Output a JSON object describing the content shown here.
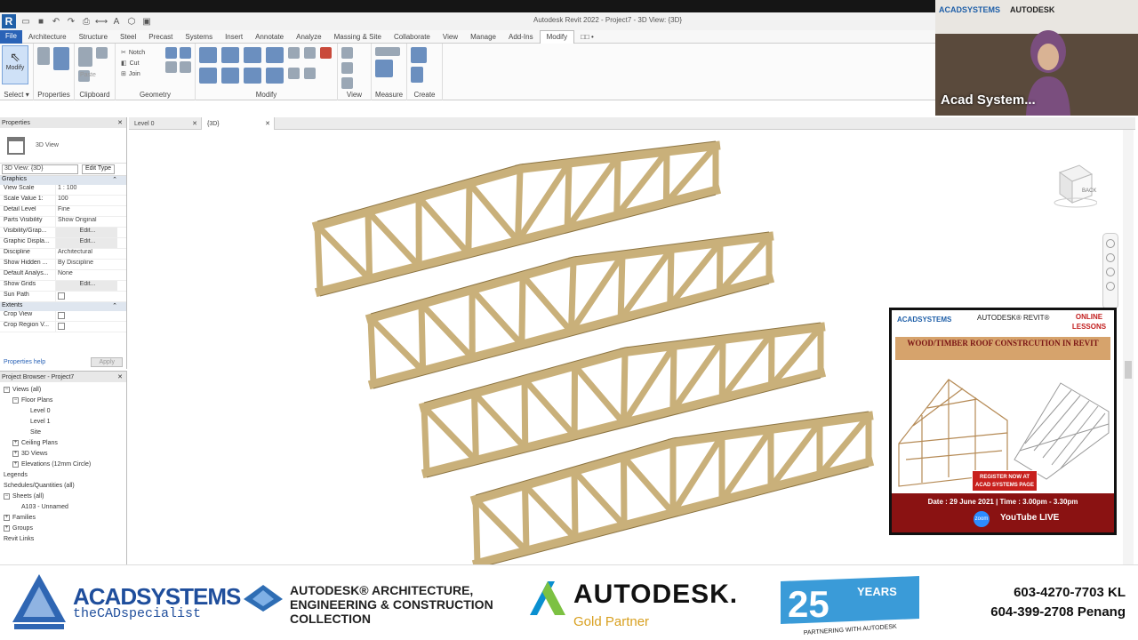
{
  "app": {
    "window_title": "Autodesk Revit 2022 - Project7 - 3D View: {3D}"
  },
  "ribbon": {
    "file_tab": "File",
    "tabs": [
      "Architecture",
      "Structure",
      "Steel",
      "Precast",
      "Systems",
      "Insert",
      "Annotate",
      "Analyze",
      "Massing & Site",
      "Collaborate",
      "View",
      "Manage",
      "Add-Ins",
      "Modify",
      "□□ •"
    ],
    "active_tab": "Modify",
    "modify_button": "Modify",
    "panels": {
      "select": "Select ▾",
      "properties": "Properties",
      "clipboard": "Clipboard",
      "geometry": "Geometry",
      "modify": "Modify",
      "view": "View",
      "measure": "Measure",
      "create": "Create"
    },
    "geometry_items": [
      "Notch",
      "Cut",
      "Join"
    ],
    "paste_label": "Paste"
  },
  "properties": {
    "title": "Properties",
    "type_name": "3D View",
    "view_selector": "3D View: {3D}",
    "edit_type": "Edit Type",
    "group_graphics": "Graphics",
    "rows": [
      {
        "key": "View Scale",
        "value": "1 : 100"
      },
      {
        "key": "Scale Value    1:",
        "value": "100"
      },
      {
        "key": "Detail Level",
        "value": "Fine"
      },
      {
        "key": "Parts Visibility",
        "value": "Show Original"
      },
      {
        "key": "Visibility/Grap...",
        "value": "Edit..."
      },
      {
        "key": "Graphic Displa...",
        "value": "Edit..."
      },
      {
        "key": "Discipline",
        "value": "Architectural"
      },
      {
        "key": "Show Hidden ...",
        "value": "By Discipline"
      },
      {
        "key": "Default Analys...",
        "value": "None"
      },
      {
        "key": "Show Grids",
        "value": "Edit..."
      },
      {
        "key": "Sun Path",
        "value": ""
      }
    ],
    "group_extents": "Extents",
    "extent_rows": [
      {
        "key": "Crop View",
        "value": ""
      },
      {
        "key": "Crop Region V...",
        "value": ""
      }
    ],
    "help_link": "Properties help",
    "apply": "Apply"
  },
  "project_browser": {
    "title": "Project Browser - Project7",
    "nodes": [
      {
        "label": "Views (all)",
        "indent": 0,
        "toggle": "−"
      },
      {
        "label": "Floor Plans",
        "indent": 1,
        "toggle": "−"
      },
      {
        "label": "Level 0",
        "indent": 3,
        "toggle": ""
      },
      {
        "label": "Level 1",
        "indent": 3,
        "toggle": ""
      },
      {
        "label": "Site",
        "indent": 3,
        "toggle": ""
      },
      {
        "label": "Ceiling Plans",
        "indent": 1,
        "toggle": "+"
      },
      {
        "label": "3D Views",
        "indent": 1,
        "toggle": "+"
      },
      {
        "label": "Elevations (12mm Circle)",
        "indent": 1,
        "toggle": "+"
      },
      {
        "label": "Legends",
        "indent": 0,
        "toggle": ""
      },
      {
        "label": "Schedules/Quantities (all)",
        "indent": 0,
        "toggle": ""
      },
      {
        "label": "Sheets (all)",
        "indent": 0,
        "toggle": "−"
      },
      {
        "label": "A103 - Unnamed",
        "indent": 2,
        "toggle": ""
      },
      {
        "label": "Families",
        "indent": 0,
        "toggle": "+"
      },
      {
        "label": "Groups",
        "indent": 0,
        "toggle": "+"
      },
      {
        "label": "Revit Links",
        "indent": 0,
        "toggle": ""
      }
    ]
  },
  "viewport": {
    "tabs": [
      {
        "label": "Level 0",
        "active": false
      },
      {
        "label": "{3D}",
        "active": true
      }
    ],
    "viewcube_face": "BACK",
    "truss_color": "#c9b07a",
    "truss_count": 4
  },
  "webcam": {
    "participant_name": "Acad System...",
    "wall_logo_1": "ACADSYSTEMS",
    "wall_logo_2": "AUTODESK"
  },
  "poster": {
    "logo_1": "ACADSYSTEMS",
    "logo_2": "AUTODESK® REVIT®",
    "online_lessons": "ONLINE LESSONS",
    "title": "WOOD/TIMBER ROOF CONSTRCUTION IN REVIT",
    "register": "REGISTER NOW AT ACAD SYSTEMS PAGE",
    "date_line": "Date : 29 June 2021 | Time : 3.00pm - 3.30pm",
    "zoom": "zoom",
    "youtube": "YouTube LIVE"
  },
  "footer": {
    "acad_name": "ACADSYSTEMS",
    "acad_tag": "theCADspecialist",
    "aec": "AUTODESK® ARCHITECTURE, ENGINEERING & CONSTRUCTION COLLECTION",
    "autodesk": "AUTODESK.",
    "gold_partner": "Gold Partner",
    "years_num": "25",
    "years_word": "YEARS",
    "years_tag": "PARTNERING WITH AUTODESK",
    "phone_kl": "603-4270-7703 KL",
    "phone_penang": "604-399-2708 Penang"
  }
}
